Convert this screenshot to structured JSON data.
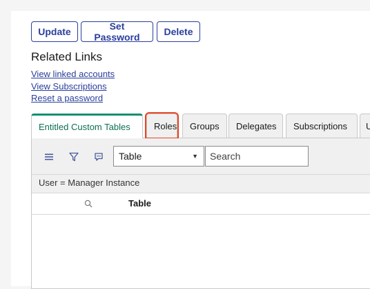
{
  "buttons": {
    "update": "Update",
    "set_password": "Set Password",
    "delete": "Delete"
  },
  "related": {
    "title": "Related Links",
    "links": [
      "View linked accounts",
      "View Subscriptions",
      "Reset a password"
    ]
  },
  "tabs": [
    {
      "label": "Entitled Custom Tables",
      "active": true
    },
    {
      "label": "Roles",
      "highlighted": true
    },
    {
      "label": "Groups"
    },
    {
      "label": "Delegates"
    },
    {
      "label": "Subscriptions"
    },
    {
      "label": "U"
    }
  ],
  "toolbar": {
    "icons": [
      "hamburger-menu-icon",
      "filter-icon",
      "comment-icon"
    ],
    "select_value": "Table",
    "search_placeholder": "Search"
  },
  "filter": {
    "text": "User = Manager Instance"
  },
  "table": {
    "columns": [
      "Table"
    ]
  },
  "colors": {
    "accent": "#293e9c",
    "active_tab": "#0f8f6e",
    "highlight": "#e8441f"
  }
}
